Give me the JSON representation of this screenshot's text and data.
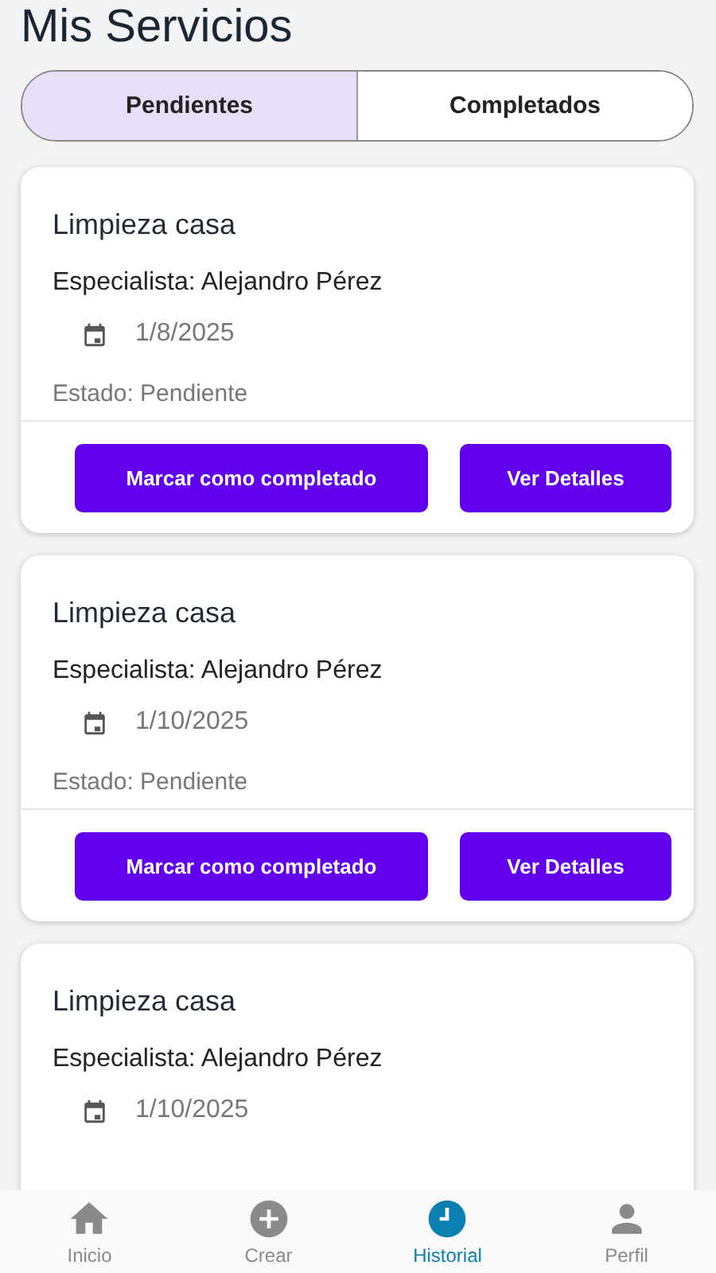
{
  "header": {
    "title": "Mis Servicios"
  },
  "tabs": [
    {
      "label": "Pendientes",
      "selected": true
    },
    {
      "label": "Completados",
      "selected": false
    }
  ],
  "services": [
    {
      "title": "Limpieza casa",
      "specialist": "Especialista: Alejandro Pérez",
      "date": "1/8/2025",
      "status": "Estado: Pendiente",
      "actions": [
        "Marcar como completado",
        "Ver Detalles"
      ]
    },
    {
      "title": "Limpieza casa",
      "specialist": "Especialista: Alejandro Pérez",
      "date": "1/10/2025",
      "status": "Estado: Pendiente",
      "actions": [
        "Marcar como completado",
        "Ver Detalles"
      ]
    },
    {
      "title": "Limpieza casa",
      "specialist": "Especialista: Alejandro Pérez",
      "date": "1/10/2025"
    }
  ],
  "bottom_nav": [
    {
      "kind": "home",
      "label": "Inicio",
      "selected": false
    },
    {
      "kind": "create",
      "label": "Crear",
      "selected": false
    },
    {
      "kind": "history",
      "label": "Historial",
      "selected": true
    },
    {
      "kind": "profile",
      "label": "Perfil",
      "selected": false
    }
  ]
}
